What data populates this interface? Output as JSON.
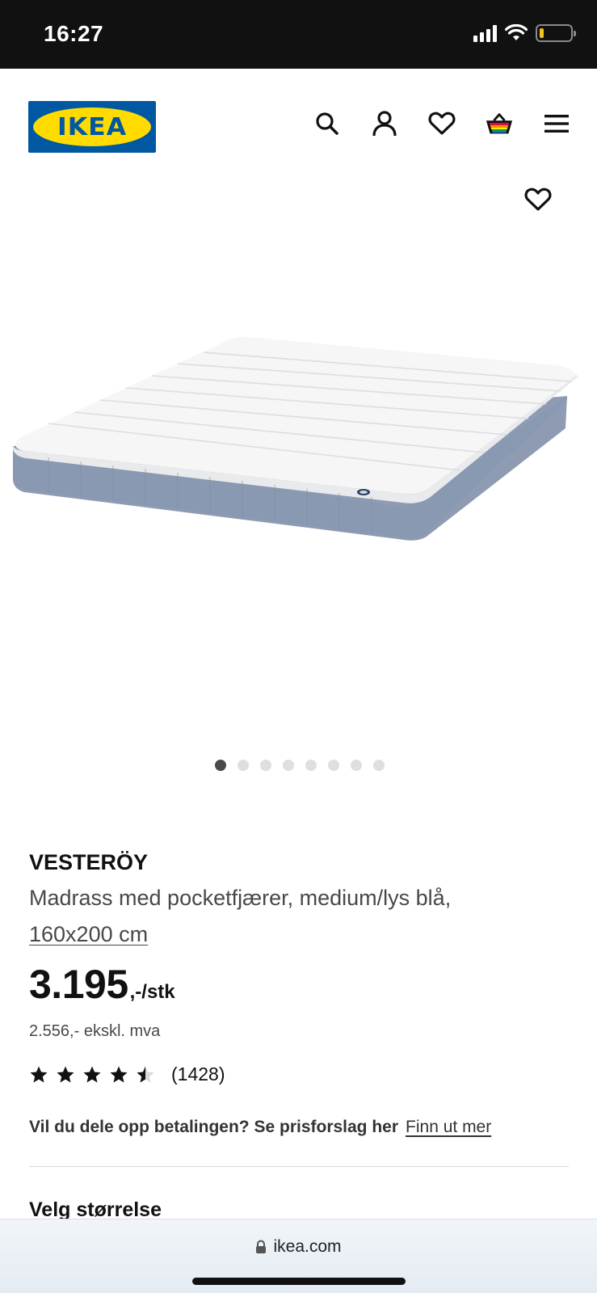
{
  "status_bar": {
    "time": "16:27",
    "icons": [
      "signal-icon",
      "wifi-icon",
      "battery-icon"
    ]
  },
  "header": {
    "logo_text": "IKEA",
    "icons": [
      "search-icon",
      "account-icon",
      "heart-icon",
      "basket-icon",
      "menu-icon"
    ]
  },
  "colors": {
    "brand_blue": "#0058a3",
    "brand_yellow": "#ffdb00",
    "mattress_side": "#8e9bb3"
  },
  "gallery": {
    "total_images": 8,
    "active_index": 0
  },
  "product": {
    "name": "VESTERÖY",
    "description": "Madrass med pocketfjærer, medium/lys blå,",
    "size": "160x200 cm",
    "price": "3.195",
    "price_suffix": ",-/stk",
    "price_ex_vat": "2.556,- ekskl. mva",
    "rating": 4.5,
    "rating_count": "(1428)",
    "payment_text": "Vil du dele opp betalingen? Se prisforslag her",
    "payment_link": "Finn ut mer",
    "size_heading": "Velg størrelse"
  },
  "browser": {
    "url": "ikea.com"
  }
}
